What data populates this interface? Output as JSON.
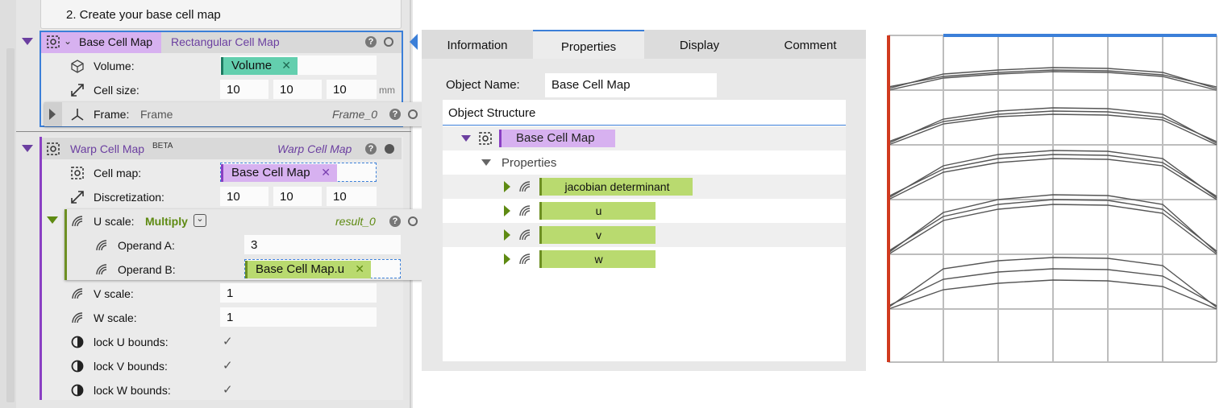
{
  "step": {
    "text": "2. Create your base cell map"
  },
  "base_cell_map": {
    "title": "Base Cell Map",
    "subtitle": "Rectangular Cell Map",
    "volume_label": "Volume:",
    "volume_value": "Volume",
    "cell_size_label": "Cell size:",
    "cell_size": [
      "10",
      "10",
      "10"
    ],
    "cell_size_unit": "mm",
    "frame_label": "Frame:",
    "frame_value": "Frame",
    "frame_output": "Frame_0"
  },
  "warp_cell_map": {
    "title": "Warp Cell Map",
    "badge": "BETA",
    "type": "Warp Cell Map",
    "cell_map_label": "Cell map:",
    "cell_map_value": "Base Cell Map",
    "discretization_label": "Discretization:",
    "discretization": [
      "10",
      "10",
      "10"
    ],
    "u_scale_label": "U scale:",
    "u_scale_op": "Multiply",
    "u_scale_output": "result_0",
    "operand_a_label": "Operand A:",
    "operand_a_value": "3",
    "operand_b_label": "Operand B:",
    "operand_b_value": "Base Cell Map.u",
    "v_scale_label": "V scale:",
    "v_scale_value": "1",
    "w_scale_label": "W scale:",
    "w_scale_value": "1",
    "lock_u_label": "lock U bounds:",
    "lock_v_label": "lock V bounds:",
    "lock_w_label": "lock W bounds:",
    "check_mark": "✓"
  },
  "tabs": [
    "Information",
    "Properties",
    "Display",
    "Comment"
  ],
  "info": {
    "object_name_label": "Object Name:",
    "object_name_value": "Base Cell Map",
    "structure_label": "Object Structure",
    "root": "Base Cell Map",
    "properties_label": "Properties",
    "props": [
      "jacobian determinant",
      "u",
      "v",
      "w"
    ]
  },
  "icons": {
    "help": "?",
    "remove": "✕",
    "dropdown": "⌄"
  },
  "colors": {
    "purple_tag": "#d7b1f0",
    "purple_accent": "#8a3fc3",
    "teal_tag": "#63cfae",
    "green_tag": "#b9da6f",
    "selection_blue": "#3b7fd8",
    "axis_red": "#d03a1f"
  }
}
